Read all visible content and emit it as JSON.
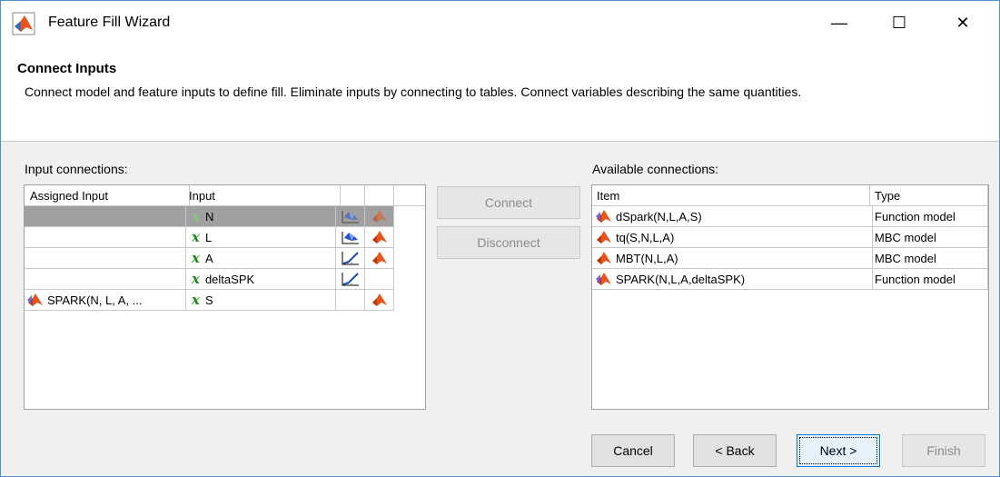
{
  "window": {
    "title": "Feature Fill Wizard",
    "minimize": "—",
    "maximize": "☐",
    "close": "✕"
  },
  "header": {
    "title": "Connect Inputs",
    "description": "Connect model and feature inputs to define fill. Eliminate inputs by connecting to tables. Connect variables describing the same quantities."
  },
  "input_connections": {
    "label": "Input connections:",
    "columns": [
      "Assigned Input",
      "Input",
      "",
      ""
    ],
    "rows": [
      {
        "assigned": "",
        "input": "N",
        "icon1": "surface-icon",
        "icon2": "model-icon",
        "selected": true
      },
      {
        "assigned": "",
        "input": "L",
        "icon1": "surface-icon",
        "icon2": "model-icon",
        "selected": false
      },
      {
        "assigned": "",
        "input": "A",
        "icon1": "curve-icon",
        "icon2": "model-icon",
        "selected": false
      },
      {
        "assigned": "",
        "input": "deltaSPK",
        "icon1": "curve-icon",
        "icon2": "",
        "selected": false
      },
      {
        "assigned": "SPARK(N, L, A, ...",
        "input": "S",
        "icon1": "",
        "icon2": "model-icon",
        "selected": false
      }
    ]
  },
  "middle_buttons": {
    "connect": "Connect",
    "disconnect": "Disconnect"
  },
  "available_connections": {
    "label": "Available connections:",
    "columns": [
      "Item",
      "Type"
    ],
    "rows": [
      {
        "item": "dSpark(N,L,A,S)",
        "type": "Function model",
        "icon": "function-model-icon"
      },
      {
        "item": "tq(S,N,L,A)",
        "type": "MBC model",
        "icon": "mbc-model-icon"
      },
      {
        "item": "MBT(N,L,A)",
        "type": "MBC model",
        "icon": "mbc-model-icon"
      },
      {
        "item": "SPARK(N,L,A,deltaSPK)",
        "type": "Function model",
        "icon": "function-model-icon"
      }
    ]
  },
  "footer": {
    "cancel": "Cancel",
    "back": "< Back",
    "next": "Next >",
    "finish": "Finish"
  },
  "colors": {
    "accent": "#0078d7",
    "selected_row": "#a0a0a0",
    "x_symbol": "#1f8c1f",
    "matlab_orange": "#e8541b"
  }
}
